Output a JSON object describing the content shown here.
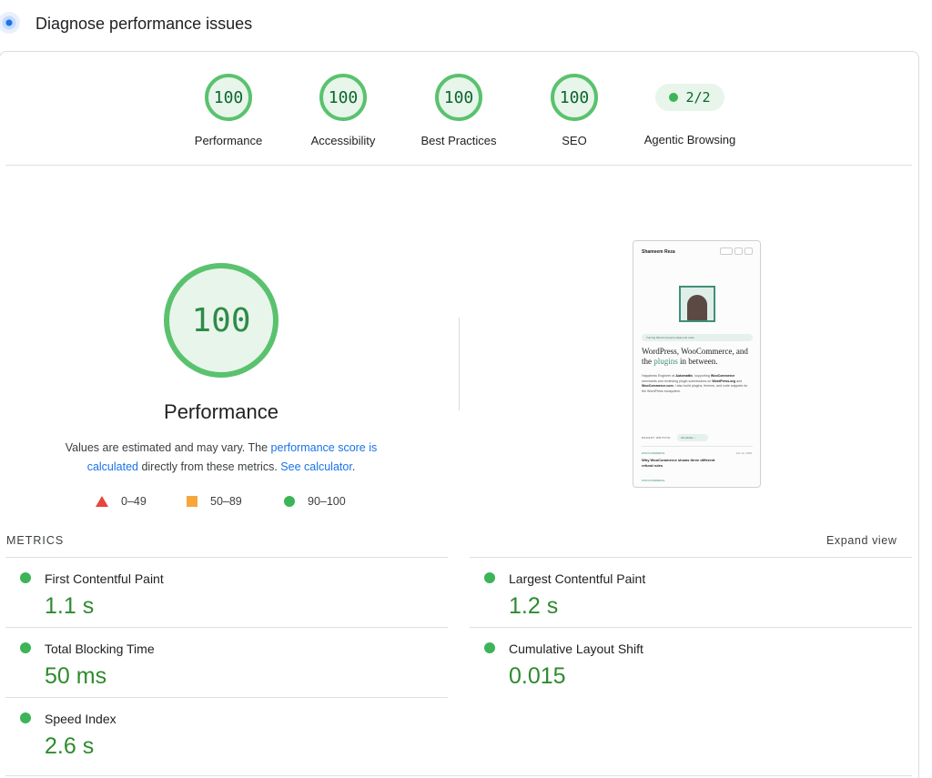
{
  "header": {
    "title": "Diagnose performance issues",
    "icon": "lighthouse-icon"
  },
  "categories": [
    {
      "score": "100",
      "label": "Performance"
    },
    {
      "score": "100",
      "label": "Accessibility"
    },
    {
      "score": "100",
      "label": "Best Practices"
    },
    {
      "score": "100",
      "label": "SEO"
    }
  ],
  "agentic": {
    "value": "2/2",
    "label": "Agentic Browsing"
  },
  "performance": {
    "score": "100",
    "title": "Performance",
    "note_prefix": "Values are estimated and may vary. The ",
    "note_link1": "performance score is calculated",
    "note_middle": " directly from these metrics. ",
    "note_link2": "See calculator",
    "note_suffix": "."
  },
  "legend": [
    {
      "shape": "triangle",
      "color": "#e8453c",
      "range": "0–49"
    },
    {
      "shape": "square",
      "color": "#f5a73b",
      "range": "50–89"
    },
    {
      "shape": "circle",
      "color": "#3cb457",
      "range": "90–100"
    }
  ],
  "screenshot": {
    "site_name": "Shameem Reza",
    "tag": "Turning WooCommerce ideas into code",
    "headline_1": "WordPress, WooCommerce, and the ",
    "headline_accent": "plugins",
    "headline_2": " in between.",
    "body_1": "Happiness Engineer at ",
    "body_b1": "Automattic",
    "body_2": ", supporting ",
    "body_b2": "WooCommerce",
    "body_3": " merchants and reviewing plugin submissions on ",
    "body_b3": "WordPress.org",
    "body_4": " and ",
    "body_b4": "WooCommerce.com",
    "body_5": ". I also build plugins, themes, and code snippets for the WordPress ecosystem.",
    "recent_label": "RECENT WRITING",
    "recent_button": "All articles →",
    "post_tag": "WOOCOMMERCE",
    "post_date": "JUL 12, 2025",
    "post_title": "Why WooCommerce shows three different refund rules",
    "post_tag2": "WOOCOMMERCE"
  },
  "metrics": {
    "title": "METRICS",
    "expand": "Expand view",
    "items": [
      {
        "name": "First Contentful Paint",
        "value": "1.1 s"
      },
      {
        "name": "Largest Contentful Paint",
        "value": "1.2 s"
      },
      {
        "name": "Total Blocking Time",
        "value": "50 ms"
      },
      {
        "name": "Cumulative Layout Shift",
        "value": "0.015"
      },
      {
        "name": "Speed Index",
        "value": "2.6 s"
      }
    ]
  },
  "colors": {
    "pass": "#3cb457",
    "pass_text": "#0d652d",
    "link": "#1a73e8"
  }
}
